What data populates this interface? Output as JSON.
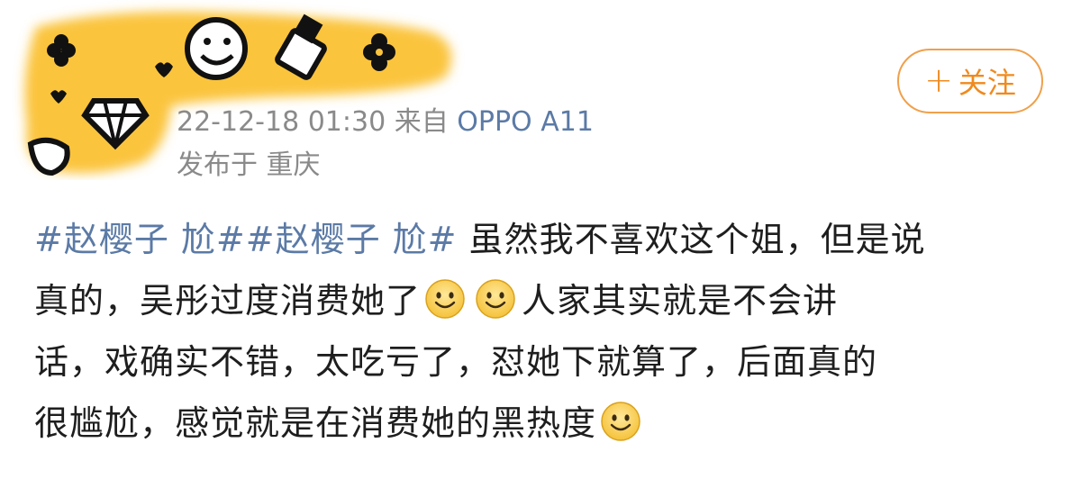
{
  "post": {
    "time": "22-12-18 01:30",
    "source_prefix": "来自",
    "device": "OPPO A11",
    "location": "发布于 重庆",
    "follow_plus": "+",
    "follow_label": "关注",
    "content": {
      "line1_topic": "#赵樱子 尬##赵樱子 尬#",
      "line1_text": " 虽然我不喜欢这个姐，但是说",
      "line2_text": "真的，吴彤过度消费她了",
      "line2_after": "人家其实就是不会讲",
      "line3_text": "话，戏确实不错，太吃亏了，怼她下就算了，后面真的",
      "line4_text": "很尴尬，感觉就是在消费她的黑热度"
    }
  },
  "colors": {
    "link": "#5b7aa6",
    "follow": "#f08a1e",
    "meta": "#8a8a8a",
    "cover": "#fbc43c"
  },
  "icons": {
    "emoji": "smile-emoji-icon"
  }
}
